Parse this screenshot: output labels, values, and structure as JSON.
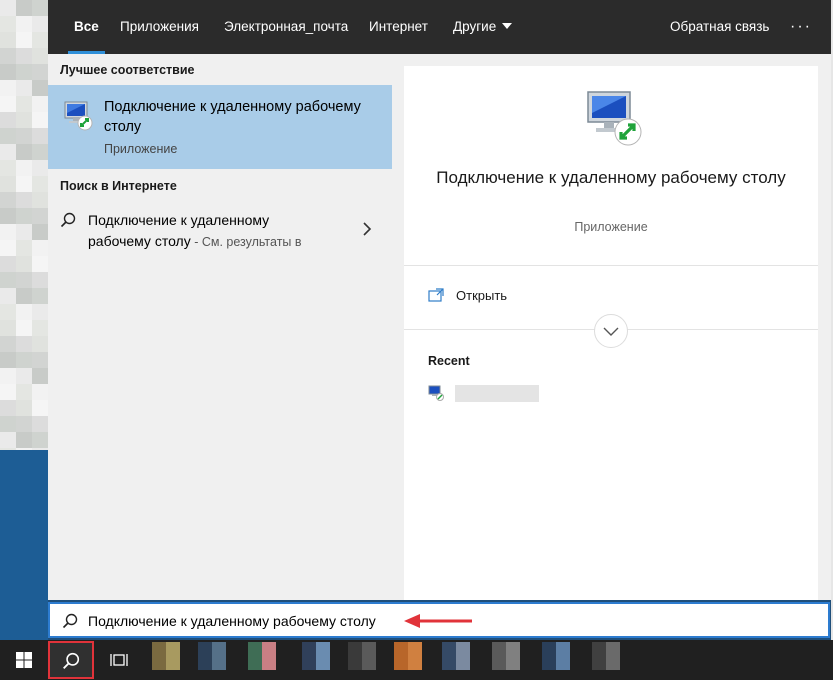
{
  "tabs": [
    {
      "label": "Все",
      "active": true
    },
    {
      "label": "Приложения"
    },
    {
      "label": "Электронная_почта"
    },
    {
      "label": "Интернет"
    },
    {
      "label": "Другие"
    }
  ],
  "feedback_label": "Обратная связь",
  "more_label": "···",
  "best_match": {
    "section_title": "Лучшее соответствие",
    "title": "Подключение к удаленному рабочему столу",
    "type": "Приложение",
    "icon": "remote-desktop-icon"
  },
  "web_search": {
    "section_title": "Поиск в Интернете",
    "query": "Подключение к удаленному рабочему столу",
    "suffix": " - См. результаты в"
  },
  "preview": {
    "title": "Подключение к удаленному рабочему столу",
    "type": "Приложение",
    "open_label": "Открыть",
    "recent_title": "Recent"
  },
  "search_box": {
    "value": "Подключение к удаленному рабочему столу"
  },
  "colors": {
    "accent": "#2f8fd8",
    "selected": "#a9cce8",
    "topbar": "#2b2b2b",
    "taskbar": "#202020",
    "highlight_red": "#e1333a"
  }
}
